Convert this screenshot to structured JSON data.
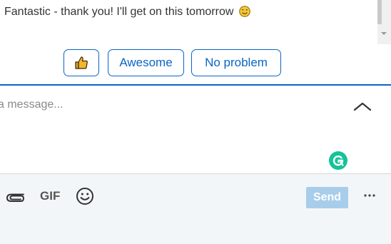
{
  "thread": {
    "last_message": "Fantastic - thank you! I'll get on this tomorrow",
    "emoji": "smiling-face"
  },
  "suggested_replies": {
    "thumb": "👍",
    "awesome": "Awesome",
    "no_problem": "No problem"
  },
  "compose": {
    "placeholder": "a message..."
  },
  "toolbar": {
    "gif_label": "GIF",
    "send_label": "Send"
  },
  "colors": {
    "accent": "#0a66c2",
    "send_disabled": "#a8cdea",
    "grammarly": "#15c39a",
    "footer_bg": "#f3f6f8"
  }
}
